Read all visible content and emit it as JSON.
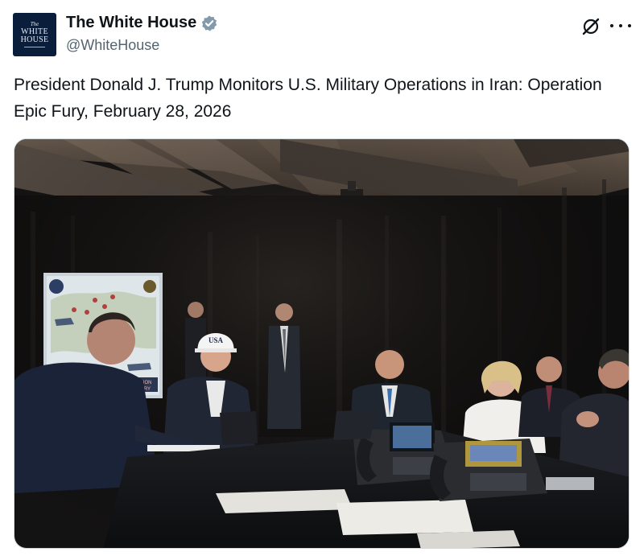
{
  "author": {
    "display_name": "The White House",
    "handle": "@WhiteHouse",
    "avatar": {
      "line1": "The",
      "line2": "WHITE",
      "line3": "HOUSE"
    },
    "verified_icon": "verified-badge-icon"
  },
  "actions": {
    "grok_icon": "grok-icon",
    "more_icon": "more-icon"
  },
  "post": {
    "text": "President Donald J. Trump Monitors U.S. Military Operations in Iran: Operation Epic Fury, February 28, 2026"
  },
  "media": {
    "cap_text": "USA",
    "map_text_line1": "OPERATION",
    "map_text_line2": "EPIC FURY"
  },
  "colors": {
    "verified_badge": "#829aab",
    "avatar_bg": "#0a1d3a",
    "handle": "#536471"
  }
}
